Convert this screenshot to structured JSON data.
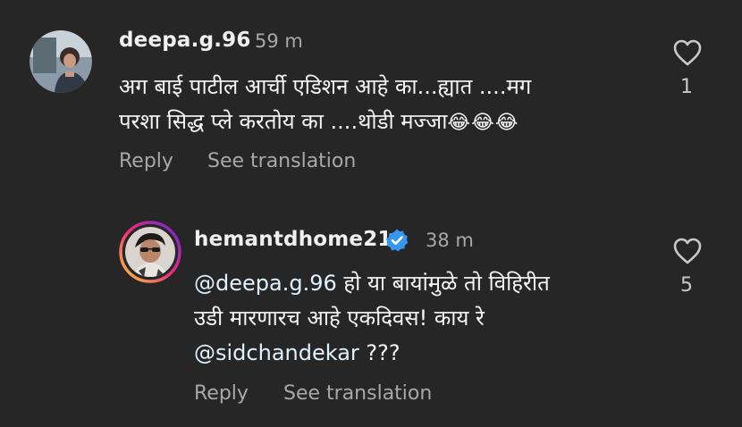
{
  "comments": [
    {
      "username": "deepa.g.96",
      "time": "59 m",
      "lines": [
        "अग बाई पाटील आर्ची एडिशन आहे का...ह्यात ....मग",
        "परशा सिद्ध प्ले करतोय का ....थोडी मज्जा"
      ],
      "emojis": "😂😂😂",
      "reply_label": "Reply",
      "translate_label": "See translation",
      "like_count": "1",
      "avatar_icon": "user-photo-icon"
    },
    {
      "username": "hemantdhome21",
      "time": "38 m",
      "verified": true,
      "mention1": "@deepa.g.96",
      "line1_rest": " हो या बायांमुळे तो विहिरीत",
      "line2": "उडी मारणारच आहे एकदिवस! काय रे",
      "mention2": "@sidchandekar",
      "line3_rest": " ???",
      "reply_label": "Reply",
      "translate_label": "See translation",
      "like_count": "5",
      "avatar_icon": "user-photo-icon",
      "story_ring_colors": [
        "#f9ce34",
        "#ee2a7b",
        "#6228d7"
      ]
    }
  ],
  "colors": {
    "background": "#262626",
    "secondary_text": "#a8a8a8",
    "verified_blue": "#3797f0"
  }
}
